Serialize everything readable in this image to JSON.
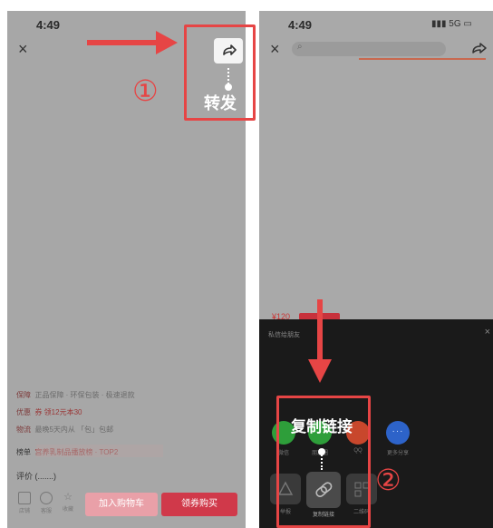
{
  "left_screen": {
    "time": "4:49",
    "close_glyph": "×",
    "share_icon": "share-arrow-icon",
    "forward_label": "转发",
    "step_marker": "①",
    "rows": [
      {
        "label": "保障",
        "text": "正品保障 · 环保包装 · 极速退款"
      },
      {
        "label": "优惠",
        "text": "券  领12元本30"
      },
      {
        "label": "物流",
        "text": "最晚5天内从        「包」包邮"
      },
      {
        "label": "榜单",
        "text": "宫养乳制品播放榜 · TOP2"
      }
    ],
    "reviews_label": "评价 (.......)",
    "bottom_icons": [
      {
        "icon": "store-icon",
        "label": "店铺"
      },
      {
        "icon": "service-icon",
        "label": "客服"
      },
      {
        "icon": "star-icon",
        "label": "收藏"
      }
    ],
    "add_cart_label": "加入购物车",
    "buy_label": "领券购买"
  },
  "right_screen": {
    "time": "4:49",
    "status": "5G",
    "close_glyph": "×",
    "price_label": "¥120",
    "sheet_title": "私信给朋友",
    "sheet_close": "×",
    "copy_link_label": "复制链接",
    "step_marker": "②",
    "share_items": [
      {
        "icon": "wechat-icon",
        "label": "微信",
        "color": "#2e9e3a"
      },
      {
        "icon": "moments-icon",
        "label": "朋友圈",
        "color": "#2e9e3a"
      },
      {
        "icon": "qq-icon",
        "label": "QQ",
        "color": "#c8472c"
      },
      {
        "icon": "more-icon",
        "label": "更多分享",
        "color": "#2d63c9"
      }
    ],
    "tiles": [
      {
        "icon": "report-icon",
        "label": "举报"
      },
      {
        "icon": "link-icon",
        "label": "复制链接"
      },
      {
        "icon": "qrcode-icon",
        "label": "二维码"
      }
    ]
  },
  "colors": {
    "accent": "#e64545",
    "buy_button": "#d0394a",
    "cart_button": "#e9a0a8"
  }
}
